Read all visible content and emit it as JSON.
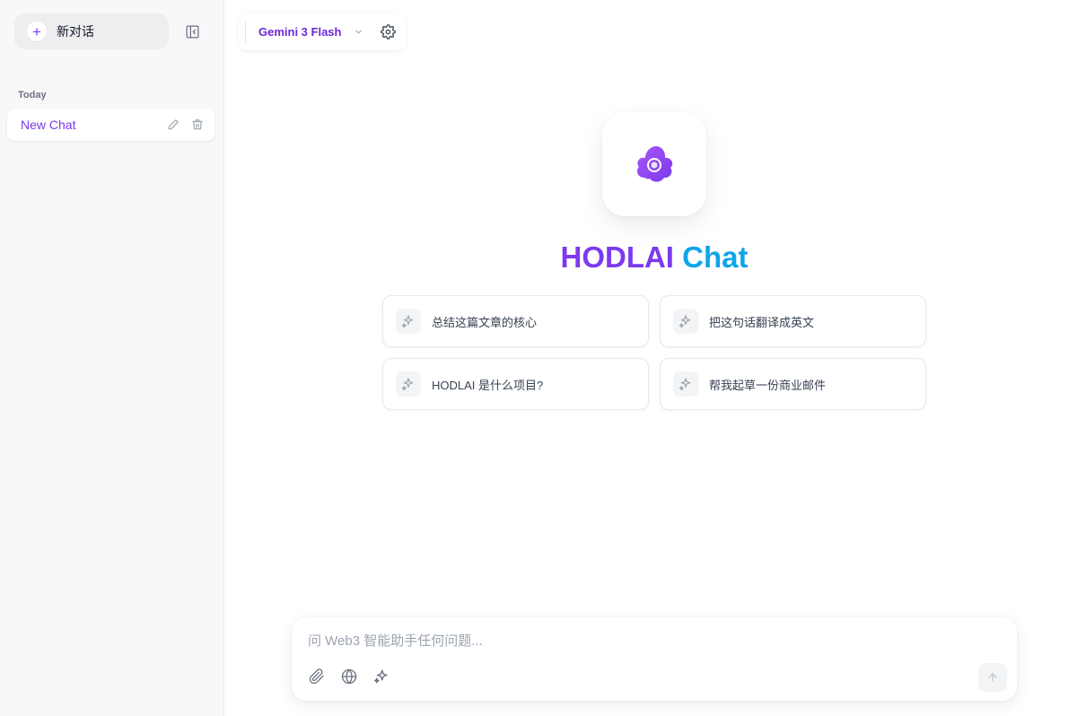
{
  "sidebar": {
    "new_chat_label": "新对话",
    "section_label": "Today",
    "items": [
      {
        "label": "New Chat"
      }
    ]
  },
  "header": {
    "model_name": "Gemini 3 Flash"
  },
  "hero": {
    "title_part1": "HODLAI",
    "title_part2": "Chat"
  },
  "suggestions": [
    {
      "label": "总结这篇文章的核心"
    },
    {
      "label": "把这句话翻译成英文"
    },
    {
      "label": "HODLAI 是什么项目?"
    },
    {
      "label": "帮我起草一份商业邮件"
    }
  ],
  "composer": {
    "placeholder": "问 Web3 智能助手任何问题..."
  },
  "colors": {
    "accent": "#7c3aed",
    "accent_secondary": "#0ea5e9",
    "sidebar_bg": "#f8f8f9"
  },
  "icons": {
    "new_chat": "plus-icon",
    "collapse": "sidebar-collapse-icon",
    "edit": "pencil-icon",
    "delete": "trash-icon",
    "model_dropdown": "chevron-down-icon",
    "settings": "gear-icon",
    "logo": "cloud-logo-icon",
    "suggestion": "sparkles-icon",
    "attach": "paperclip-icon",
    "web": "globe-icon",
    "magic": "sparkles-icon",
    "send": "arrow-up-icon"
  }
}
